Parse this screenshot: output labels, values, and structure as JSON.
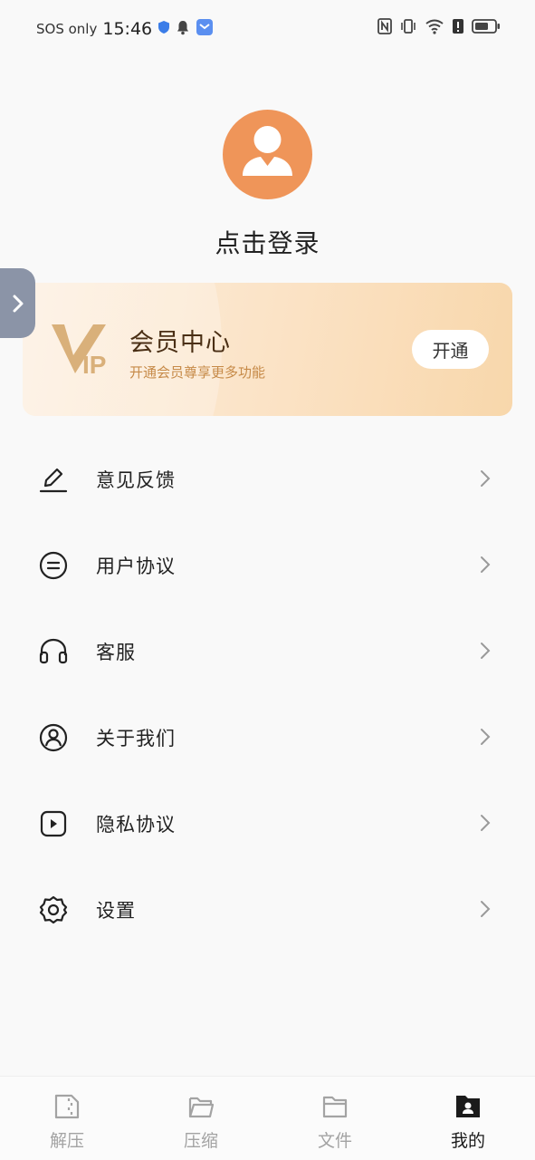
{
  "status_bar": {
    "carrier": "SOS only",
    "time": "15:46"
  },
  "profile": {
    "login_text": "点击登录"
  },
  "vip": {
    "logo_text": "VIP",
    "title": "会员中心",
    "subtitle": "开通会员尊享更多功能",
    "button": "开通"
  },
  "menu": [
    {
      "label": "意见反馈",
      "icon": "pencil-icon"
    },
    {
      "label": "用户协议",
      "icon": "document-circle-icon"
    },
    {
      "label": "客服",
      "icon": "headset-icon"
    },
    {
      "label": "关于我们",
      "icon": "user-circle-icon"
    },
    {
      "label": "隐私协议",
      "icon": "shield-play-icon"
    },
    {
      "label": "设置",
      "icon": "gear-icon"
    }
  ],
  "nav": [
    {
      "label": "解压",
      "icon": "unzip-icon",
      "active": false
    },
    {
      "label": "压缩",
      "icon": "folder-open-icon",
      "active": false
    },
    {
      "label": "文件",
      "icon": "folder-icon",
      "active": false
    },
    {
      "label": "我的",
      "icon": "profile-folder-icon",
      "active": true
    }
  ],
  "colors": {
    "avatar": "#ef9559",
    "accent_gold": "#c68a48",
    "side_tab": "#8b94a7"
  }
}
